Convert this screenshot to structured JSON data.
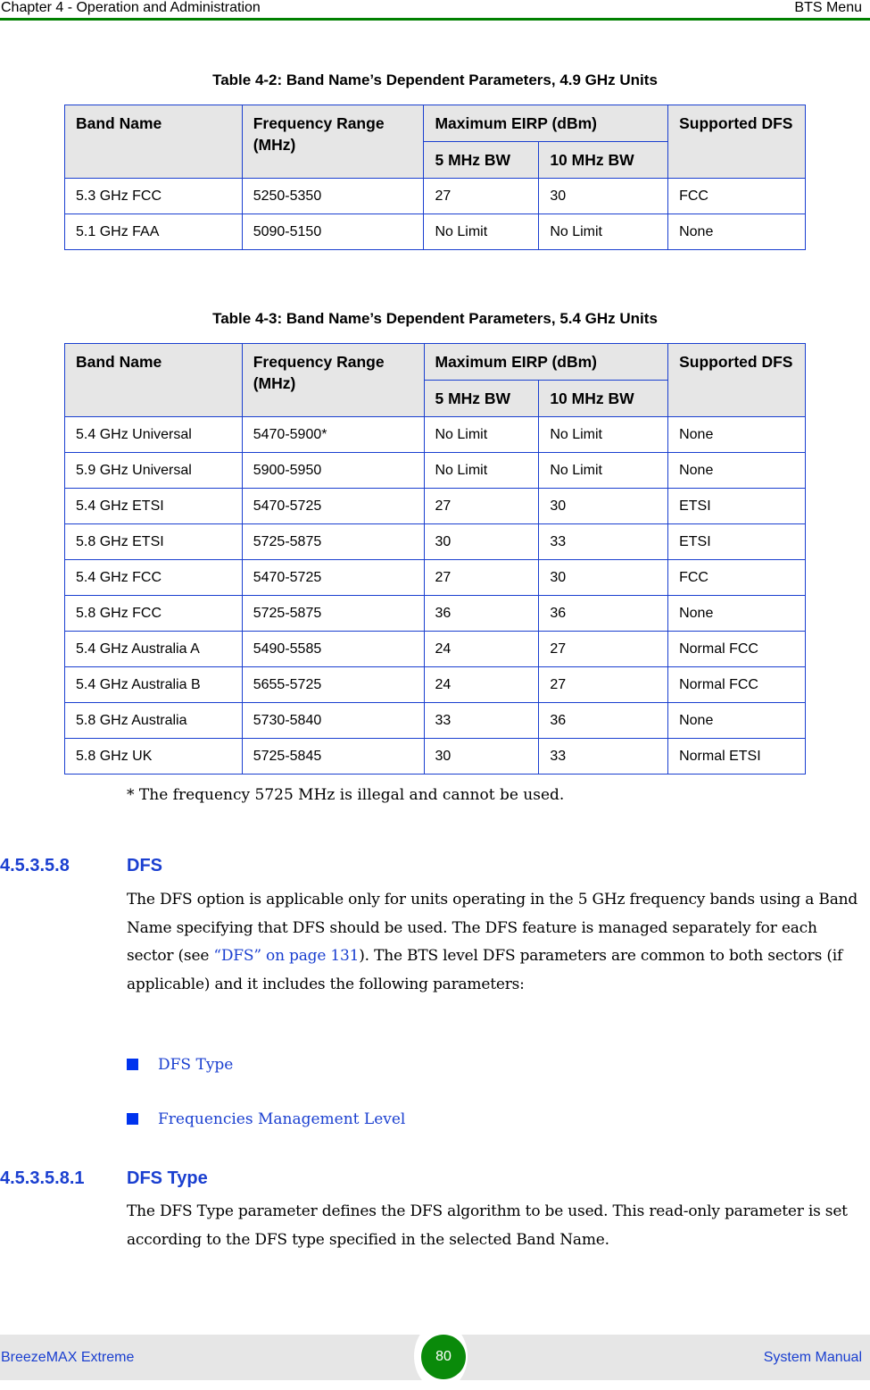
{
  "header": {
    "chapter": "Chapter 4 - Operation and Administration",
    "section": "BTS Menu"
  },
  "table_4_2": {
    "caption": "Table 4-2: Band Name’s Dependent Parameters, 4.9 GHz Units",
    "headers": {
      "band_name": "Band Name",
      "frequency_range": "Frequency Range (MHz)",
      "max_eirp": "Maximum EIRP (dBm)",
      "bw5": "5 MHz BW",
      "bw10": "10 MHz BW",
      "supported_dfs": "Supported DFS"
    },
    "rows": [
      {
        "band": "5.3 GHz FCC",
        "freq": "5250-5350",
        "bw5": "27",
        "bw10": "30",
        "dfs": "FCC"
      },
      {
        "band": "5.1 GHz FAA",
        "freq": "5090-5150",
        "bw5": "No Limit",
        "bw10": "No Limit",
        "dfs": "None"
      }
    ]
  },
  "table_4_3": {
    "caption": "Table 4-3: Band Name’s Dependent Parameters, 5.4 GHz Units",
    "headers": {
      "band_name": "Band Name",
      "frequency_range": "Frequency Range (MHz)",
      "max_eirp": "Maximum EIRP (dBm)",
      "bw5": "5 MHz BW",
      "bw10": "10 MHz BW",
      "supported_dfs": "Supported DFS"
    },
    "rows": [
      {
        "band": "5.4 GHz Universal",
        "freq": "5470-5900*",
        "bw5": "No Limit",
        "bw10": "No Limit",
        "dfs": "None"
      },
      {
        "band": "5.9 GHz Universal",
        "freq": "5900-5950",
        "bw5": "No Limit",
        "bw10": "No Limit",
        "dfs": "None"
      },
      {
        "band": "5.4 GHz ETSI",
        "freq": "5470-5725",
        "bw5": "27",
        "bw10": "30",
        "dfs": "ETSI"
      },
      {
        "band": "5.8 GHz ETSI",
        "freq": "5725-5875",
        "bw5": "30",
        "bw10": "33",
        "dfs": "ETSI"
      },
      {
        "band": "5.4 GHz FCC",
        "freq": "5470-5725",
        "bw5": "27",
        "bw10": "30",
        "dfs": "FCC"
      },
      {
        "band": "5.8 GHz FCC",
        "freq": "5725-5875",
        "bw5": "36",
        "bw10": "36",
        "dfs": "None"
      },
      {
        "band": "5.4 GHz Australia A",
        "freq": "5490-5585",
        "bw5": "24",
        "bw10": "27",
        "dfs": "Normal FCC"
      },
      {
        "band": "5.4 GHz Australia B",
        "freq": "5655-5725",
        "bw5": "24",
        "bw10": "27",
        "dfs": "Normal FCC"
      },
      {
        "band": "5.8 GHz Australia",
        "freq": "5730-5840",
        "bw5": "33",
        "bw10": "36",
        "dfs": "None"
      },
      {
        "band": "5.8 GHz UK",
        "freq": "5725-5845",
        "bw5": "30",
        "bw10": "33",
        "dfs": "Normal ETSI"
      }
    ]
  },
  "footnote": "* The frequency 5725 MHz is illegal and cannot be used.",
  "section_dfs": {
    "number": "4.5.3.5.8",
    "title": "DFS",
    "para_before_link": "The DFS option is applicable only for units operating in the 5 GHz frequency bands using a Band Name specifying that DFS should be used. The DFS feature is managed separately for each sector (see ",
    "link_text": "“DFS” on page 131",
    "para_after_link": "). The BTS level DFS parameters are common to both sectors (if applicable) and it includes the following parameters:",
    "bullets": [
      "DFS Type",
      "Frequencies Management Level"
    ]
  },
  "section_dfs_type": {
    "number": "4.5.3.5.8.1",
    "title": "DFS Type",
    "paragraph": "The DFS Type parameter defines the DFS algorithm to be used. This read-only parameter is set according to the DFS type specified in the selected Band Name."
  },
  "footer": {
    "product": "BreezeMAX Extreme",
    "page_number": "80",
    "doc_type": "System Manual"
  },
  "colors": {
    "header_rule": "#008000",
    "link_blue": "#1a3fd0",
    "table_border": "#1a3fd0",
    "table_header_bg": "#e6e6e6",
    "page_badge": "#0a8a0a"
  }
}
